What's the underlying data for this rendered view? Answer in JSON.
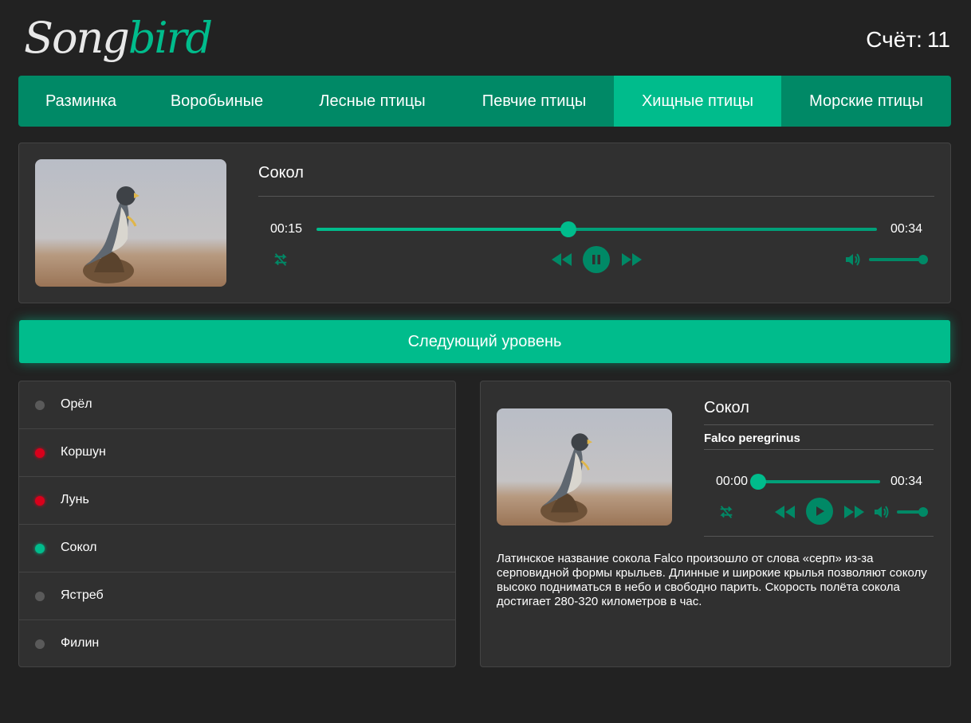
{
  "brand": {
    "part1": "Song",
    "part2": "bird"
  },
  "score": {
    "label": "Счёт:",
    "value": "11"
  },
  "nav": {
    "items": [
      {
        "label": "Разминка"
      },
      {
        "label": "Воробьиные"
      },
      {
        "label": "Лесные птицы"
      },
      {
        "label": "Певчие птицы"
      },
      {
        "label": "Хищные птицы",
        "active": true
      },
      {
        "label": "Морские птицы"
      }
    ]
  },
  "question": {
    "bird_name": "Сокол",
    "player": {
      "current_time": "00:15",
      "duration": "00:34",
      "progress": 0.44,
      "volume": 1.0,
      "state": "playing"
    }
  },
  "next_level_label": "Следующий уровень",
  "answers": [
    {
      "name": "Орёл",
      "status": "unanswered"
    },
    {
      "name": "Коршун",
      "status": "wrong"
    },
    {
      "name": "Лунь",
      "status": "wrong"
    },
    {
      "name": "Сокол",
      "status": "correct"
    },
    {
      "name": "Ястреб",
      "status": "unanswered"
    },
    {
      "name": "Филин",
      "status": "unanswered"
    }
  ],
  "details": {
    "bird_name": "Сокол",
    "latin_name": "Falco peregrinus",
    "player": {
      "current_time": "00:00",
      "duration": "00:34",
      "progress": 0.0,
      "volume": 1.0,
      "state": "paused"
    },
    "description": "Латинское название сокола Falco произошло от слова «серп» из-за серповидной формы крыльев. Длинные и широкие крылья позволяют соколу высоко подниматься в небо и свободно парить. Скорость полёта сокола достигает 280-320 километров в час."
  },
  "colors": {
    "accent": "#00bc8c",
    "nav_bg": "#008966",
    "panel_bg": "#303030",
    "page_bg": "#222222",
    "dot_wrong": "#d9001b",
    "dot_correct": "#00bc8c",
    "dot_default": "#5a5a5a"
  }
}
